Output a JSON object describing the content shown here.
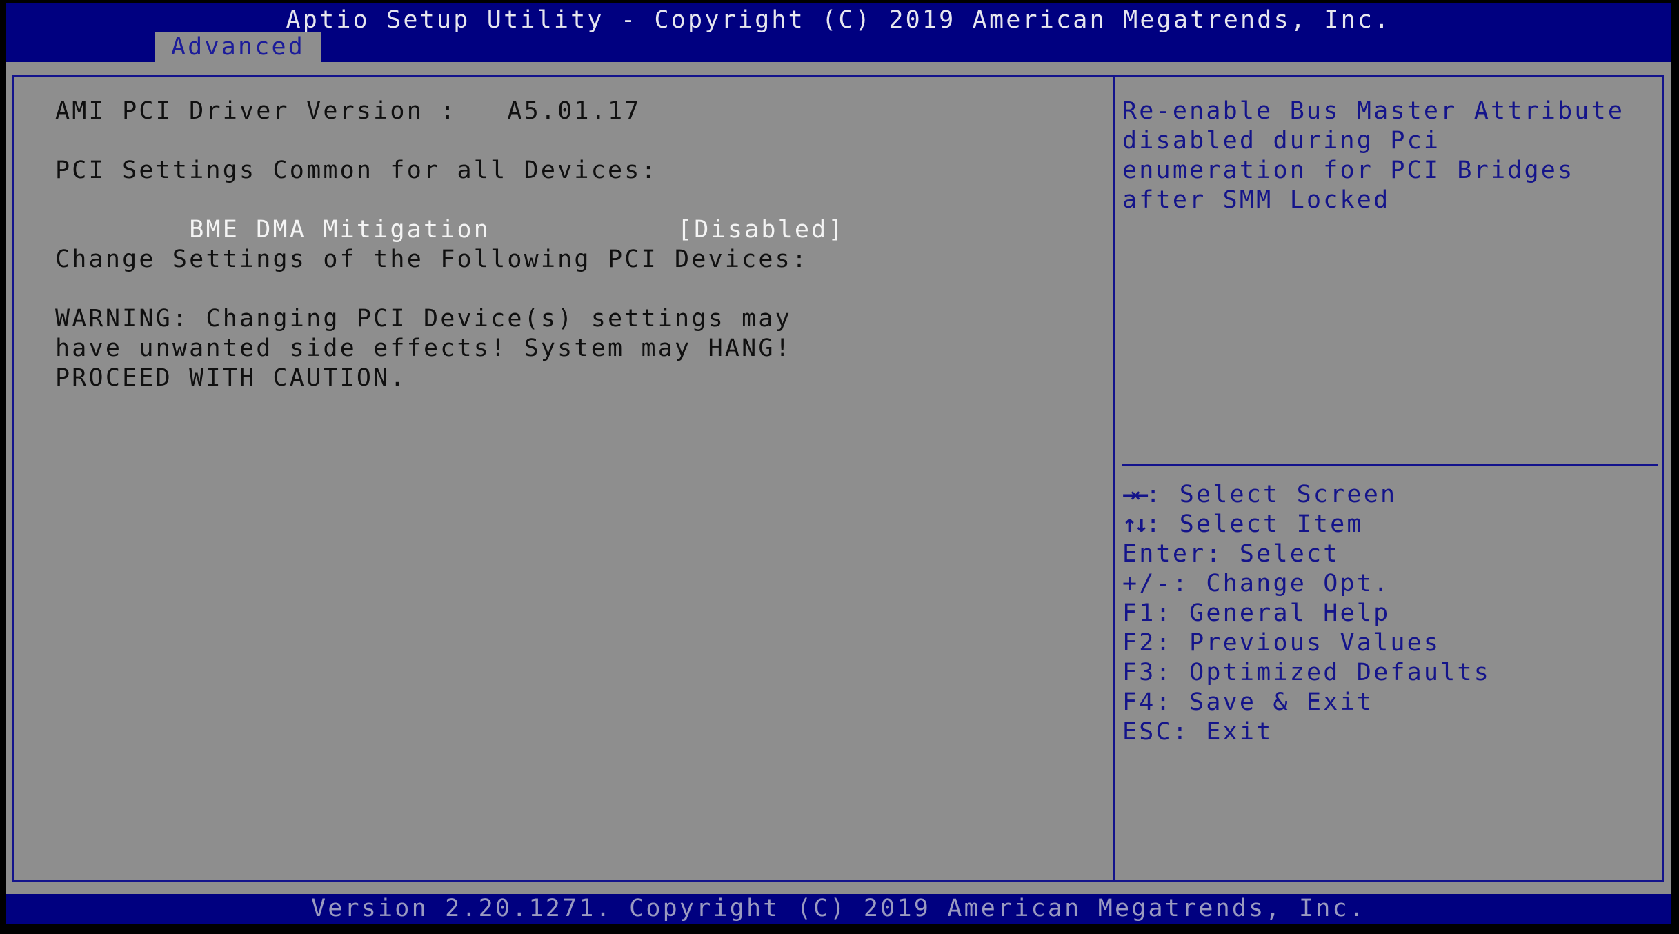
{
  "header": {
    "title": "Aptio Setup Utility - Copyright (C) 2019 American Megatrends, Inc.",
    "tabs": [
      {
        "label": "Advanced",
        "active": true
      }
    ]
  },
  "main": {
    "lines": [
      {
        "text": "AMI PCI Driver Version :   A5.01.17"
      },
      {
        "text": ""
      },
      {
        "text": "PCI Settings Common for all Devices:"
      },
      {
        "text": "BME DMA Mitigation",
        "value": "[Disabled]",
        "selected": true
      },
      {
        "text": ""
      },
      {
        "text": "Change Settings of the Following PCI Devices:"
      },
      {
        "text": ""
      },
      {
        "text": "WARNING: Changing PCI Device(s) settings may"
      },
      {
        "text": "have unwanted side effects! System may HANG!"
      },
      {
        "text": "PROCEED WITH CAUTION."
      }
    ]
  },
  "help": {
    "description": [
      "Re-enable Bus Master Attribute",
      "disabled during Pci",
      "enumeration for PCI Bridges",
      "after SMM Locked"
    ],
    "keys": [
      {
        "key": "→←",
        "action": "Select Screen",
        "icon": "left-right-arrows-icon"
      },
      {
        "key": "↑↓",
        "action": "Select Item",
        "icon": "up-down-arrows-icon"
      },
      {
        "key": "Enter",
        "action": "Select"
      },
      {
        "key": "+/-",
        "action": "Change Opt."
      },
      {
        "key": "F1",
        "action": "General Help"
      },
      {
        "key": "F2",
        "action": "Previous Values"
      },
      {
        "key": "F3",
        "action": "Optimized Defaults"
      },
      {
        "key": "F4",
        "action": "Save & Exit"
      },
      {
        "key": "ESC",
        "action": "Exit"
      }
    ]
  },
  "footer": {
    "text": "Version 2.20.1271. Copyright (C) 2019 American Megatrends, Inc."
  },
  "colors": {
    "header_bg": "#000080",
    "body_bg": "#8e8e8e",
    "accent_blue": "#14148a",
    "selected_text": "#f4f4f4"
  }
}
